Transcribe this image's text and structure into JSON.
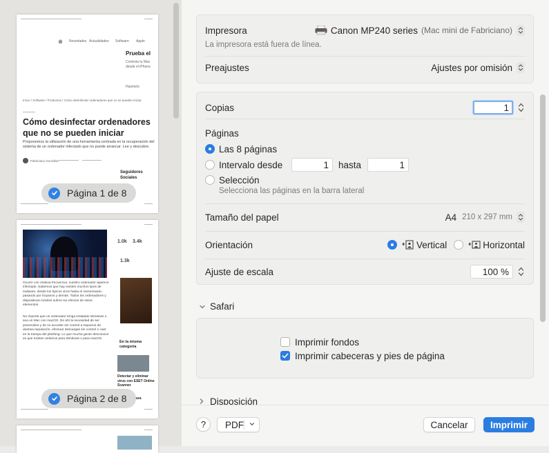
{
  "sidebar": {
    "page1": {
      "pill_label": "Página 1 de 8",
      "nav_items": [
        "Novedades",
        "Actualidades",
        "Software",
        "Apple"
      ],
      "heading_partial": "Prueba el",
      "side_text_1": "Controla tu Mac",
      "side_text_2": "desde el iPhone",
      "side_word": "Hazmelo",
      "breadcrumb": "Inicio / Software / Productos / Cómo desinfectar ordenadores que no se pueden iniciar",
      "article_title": "Cómo desinfectar ordenadores que no se pueden iniciar",
      "article_lead": "Proponemos la utilización de una herramienta centrada en la recuperación del sistema de un ordenador infectado que no puede arrancar. Lee y descubre.",
      "author": "Fabriciano González",
      "sidebar_heading": "Seguidores Sociales"
    },
    "page2": {
      "pill_label": "Página 2 de 8",
      "stats": [
        "1.0k",
        "3.4k",
        "1.3k"
      ],
      "body_1": "Ocurre con relativa frecuencia, nuestro ordenador aparece infectado. Sabemos que hay existen muchos tipos de malware, desde los típicos virus hasta el ransomware, pasando por troyanos y demás. Todos los ordenadores y dispositivos móviles sufren los efectos de estos elementos.",
      "body_2": "No importa que un ordenador tenga instalado Windows o sea un Mac con macOS. De ahí la necesidad de ser prevenidos y de no acceder sin control a espacios de dudosa reputación, efectuar descargas sin control o caer en la trampa del phishing. Lo que mucha gente desconoce es que existen antivirus para Windows o para macOS.",
      "side_heading": "En la misma categoría",
      "side_item": "Detectar y eliminar virus con ESET Online Scanner",
      "side_tail": "para"
    }
  },
  "printer": {
    "label": "Impresora",
    "icon": "printer-icon",
    "name": "Canon MP240 series",
    "host": "(Mac mini de Fabriciano)",
    "status": "La impresora está fuera de línea."
  },
  "presets": {
    "label": "Preajustes",
    "value": "Ajustes por omisión"
  },
  "copies": {
    "label": "Copias",
    "value": "1"
  },
  "pages": {
    "label": "Páginas",
    "all_label": "Las 8 páginas",
    "range_label": "Intervalo desde",
    "range_from": "1",
    "range_to_label": "hasta",
    "range_to": "1",
    "selection_label": "Selección",
    "selection_hint": "Selecciona las páginas en la barra lateral"
  },
  "paper": {
    "label": "Tamaño del papel",
    "value": "A4",
    "dimensions": "210 x 297 mm"
  },
  "orientation": {
    "label": "Orientación",
    "portrait": "Vertical",
    "landscape": "Horizontal"
  },
  "scale": {
    "label": "Ajuste de escala",
    "value": "100 %"
  },
  "safari": {
    "label": "Safari",
    "print_backgrounds": "Imprimir fondos",
    "print_headers": "Imprimir cabeceras y pies de página"
  },
  "layout_section": {
    "label": "Disposición"
  },
  "footer": {
    "help": "?",
    "pdf": "PDF",
    "cancel": "Cancelar",
    "print": "Imprimir"
  },
  "colors": {
    "accent": "#2a7de1"
  }
}
